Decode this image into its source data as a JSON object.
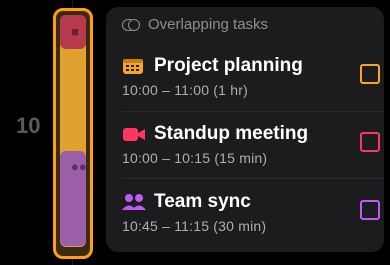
{
  "timeline": {
    "hour_label": "10",
    "block_colors": {
      "border": "#ff9f0a",
      "orange": "#e0a12e",
      "red": "#b73a4f",
      "purple": "#9b5fa8"
    }
  },
  "panel": {
    "header": "Overlapping tasks",
    "header_icon": "overlap-toggle-icon",
    "tasks": [
      {
        "title": "Project planning",
        "time": "10:00 – 11:00 (1 hr)",
        "icon": "calendar-icon",
        "color": "#f5a623"
      },
      {
        "title": "Standup meeting",
        "time": "10:00 – 10:15 (15 min)",
        "icon": "video-camera-icon",
        "color": "#ff375f"
      },
      {
        "title": "Team sync",
        "time": "10:45 – 11:15 (30 min)",
        "icon": "people-icon",
        "color": "#bf5af2"
      }
    ]
  }
}
